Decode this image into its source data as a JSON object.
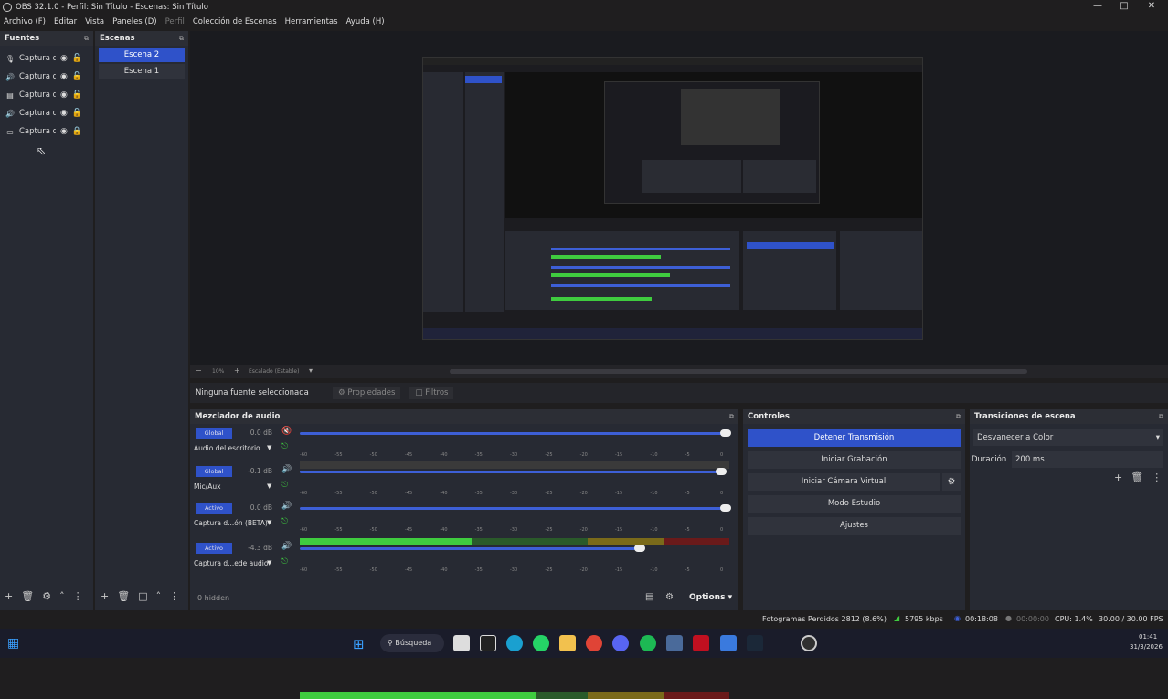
{
  "window": {
    "title": "OBS 32.1.0 - Perfil: Sin Título - Escenas: Sin Título"
  },
  "menu": [
    "Archivo (F)",
    "Editar",
    "Vista",
    "Paneles (D)",
    "Perfil",
    "Colección de Escenas",
    "Herramientas",
    "Ayuda (H)"
  ],
  "sources": {
    "title": "Fuentes",
    "items": [
      {
        "icon": "mic-icon",
        "label": "Captura d"
      },
      {
        "icon": "speaker-icon",
        "label": "Captura d"
      },
      {
        "icon": "window-capture-icon",
        "label": "Captura d"
      },
      {
        "icon": "speaker-icon",
        "label": "Captura d"
      },
      {
        "icon": "monitor-icon",
        "label": "Captura d"
      }
    ]
  },
  "scenes": {
    "title": "Escenas",
    "items": [
      {
        "label": "Escena 2",
        "selected": true
      },
      {
        "label": "Escena 1",
        "selected": false
      }
    ]
  },
  "preview_bar": {
    "zoom": "10%",
    "mode": "Escalado (Estable)"
  },
  "context": {
    "no_source": "Ninguna fuente seleccionada",
    "properties": "Propiedades",
    "filters": "Filtros"
  },
  "mixer": {
    "title": "Mezclador de audio",
    "ticks": [
      "-60",
      "-55",
      "-50",
      "-45",
      "-40",
      "-35",
      "-30",
      "-25",
      "-20",
      "-15",
      "-10",
      "-5",
      "0"
    ],
    "channels": [
      {
        "badge": "Global",
        "db": "0.0 dB",
        "name": "Audio del escritorio",
        "muted": true,
        "volume": 1.0,
        "level": 0.0
      },
      {
        "badge": "Global",
        "db": "-0.1 dB",
        "name": "Mic/Aux",
        "muted": false,
        "volume": 0.99,
        "level": 0.4
      },
      {
        "badge": "Activo",
        "db": "0.0 dB",
        "name": "Captura d...ón (BETA)",
        "muted": false,
        "volume": 1.0,
        "level": 0.0
      },
      {
        "badge": "Activo",
        "db": "-4.3 dB",
        "name": "Captura d...ede audio",
        "muted": false,
        "volume": 0.8,
        "level": 0.55
      }
    ],
    "footer": {
      "hidden": "0 hidden",
      "options": "Options"
    }
  },
  "controls": {
    "title": "Controles",
    "buttons": [
      "Detener Transmisión",
      "Iniciar Grabación",
      "Iniciar Cámara Virtual",
      "Modo Estudio",
      "Ajustes"
    ]
  },
  "transitions": {
    "title": "Transiciones de escena",
    "selected": "Desvanecer a Color",
    "duration_label": "Duración",
    "duration": "200 ms"
  },
  "status": {
    "dropped": "Fotogramas Perdidos 2812 (8.6%)",
    "bitrate": "5795 kbps",
    "stream_time": "00:18:08",
    "rec_time": "00:00:00",
    "cpu": "CPU: 1.4%",
    "fps": "30.00 / 30.00 FPS"
  },
  "taskbar": {
    "search": "Búsqueda",
    "time": "01:41",
    "date": "31/3/2026"
  },
  "colors": {
    "accent": "#2f52c9",
    "panel": "#272a33",
    "bg": "#1f1e1f",
    "meter_green": "#3fcc3f",
    "meter_yellow": "#7a6a1a",
    "meter_red": "#6a1a1a"
  }
}
